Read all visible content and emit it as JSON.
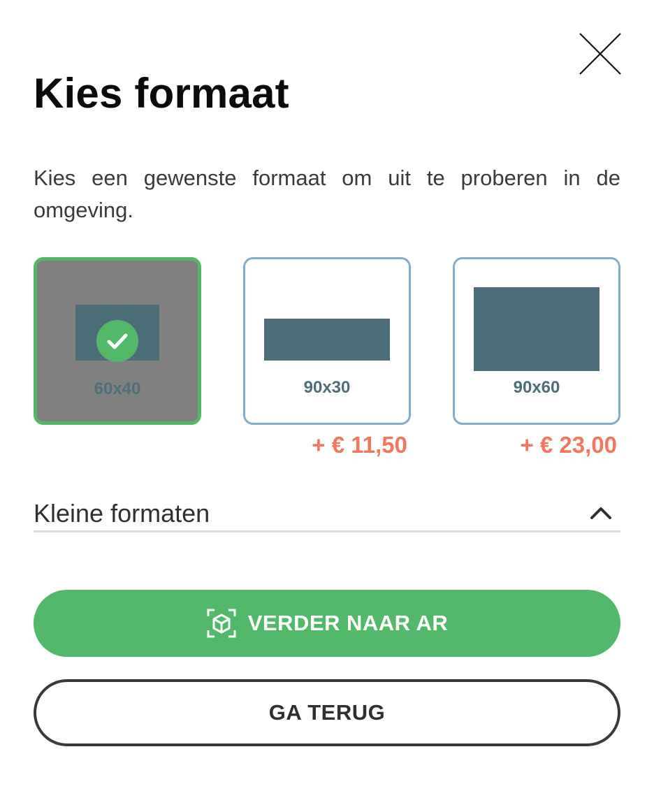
{
  "dialog": {
    "title": "Kies formaat",
    "description": "Kies een gewenste formaat om uit te proberen in de omgeving.",
    "close_icon": "close-icon"
  },
  "options": [
    {
      "label": "60x40",
      "price": "",
      "selected": true
    },
    {
      "label": "90x30",
      "price": "+ € 11,50",
      "selected": false
    },
    {
      "label": "90x60",
      "price": "+ € 23,00",
      "selected": false
    }
  ],
  "accordion": {
    "label": "Kleine formaten",
    "icon": "chevron-up-icon",
    "expanded": true
  },
  "buttons": {
    "primary_label": "VERDER NAAR AR",
    "primary_icon": "ar-cube-icon",
    "secondary_label": "GA TERUG"
  },
  "colors": {
    "accent_green": "#52b96b",
    "price_orange": "#f2775f",
    "swatch_teal": "#4d6e78",
    "option_border": "#7fb1c6"
  }
}
